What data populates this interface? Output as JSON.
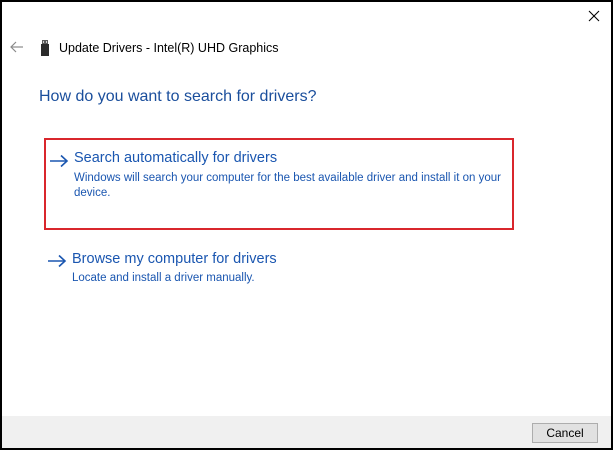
{
  "window": {
    "title": "Update Drivers - Intel(R) UHD Graphics",
    "close_icon": "close-icon",
    "back_icon": "back-arrow-icon",
    "device_icon": "usb-device-icon"
  },
  "heading": "How do you want to search for drivers?",
  "options": [
    {
      "title": "Search automatically for drivers",
      "description": "Windows will search your computer for the best available driver and install it on your device.",
      "highlighted": true,
      "icon": "right-arrow-icon"
    },
    {
      "title": "Browse my computer for drivers",
      "description": "Locate and install a driver manually.",
      "highlighted": false,
      "icon": "right-arrow-icon"
    }
  ],
  "footer": {
    "cancel_label": "Cancel"
  },
  "colors": {
    "link_blue": "#1a56b0",
    "heading_blue": "#1a4e9c",
    "highlight_red": "#d9262c",
    "footer_bg": "#f0f0f0"
  }
}
